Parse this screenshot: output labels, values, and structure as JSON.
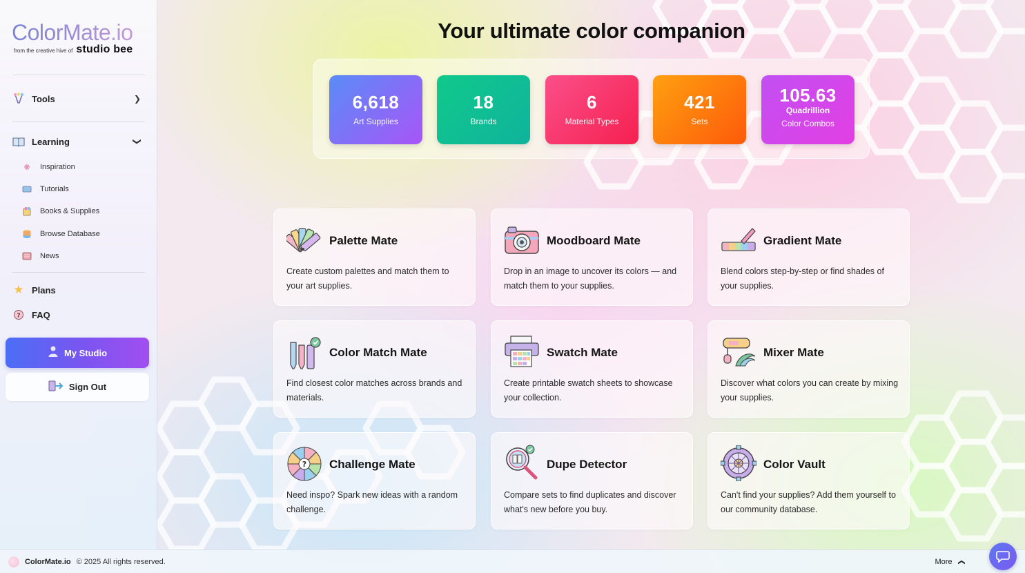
{
  "brand": {
    "title": "ColorMate.io",
    "from_text": "from the creative hive of",
    "studio_name": "studio bee"
  },
  "sidebar": {
    "tools_label": "Tools",
    "learning_label": "Learning",
    "learning_items": [
      {
        "label": "Inspiration",
        "icon": "lightbulb-icon"
      },
      {
        "label": "Tutorials",
        "icon": "video-icon"
      },
      {
        "label": "Books & Supplies",
        "icon": "books-icon"
      },
      {
        "label": "Browse Database",
        "icon": "database-icon"
      },
      {
        "label": "News",
        "icon": "newspaper-icon"
      }
    ],
    "plans_label": "Plans",
    "faq_label": "FAQ",
    "my_studio_label": "My Studio",
    "sign_out_label": "Sign Out"
  },
  "main": {
    "headline": "Your ultimate color companion",
    "stats": [
      {
        "value": "6,618",
        "label": "Art Supplies",
        "color_from": "#5a8cf7",
        "color_to": "#a855f7"
      },
      {
        "value": "18",
        "label": "Brands",
        "color_from": "#10c98b",
        "color_to": "#0fb39c"
      },
      {
        "value": "6",
        "label": "Material Types",
        "color_from": "#fb4f8a",
        "color_to": "#f5204f"
      },
      {
        "value": "421",
        "label": "Sets",
        "color_from": "#ffa010",
        "color_to": "#fd5a0a"
      },
      {
        "value": "105.63",
        "sub": "Quadrillion",
        "label": "Color Combos",
        "color_from": "#c24ff3",
        "color_to": "#e23fe2"
      }
    ],
    "cards": [
      {
        "title": "Palette Mate",
        "desc": "Create custom palettes and match them to your art supplies.",
        "icon": "palette-fan-icon"
      },
      {
        "title": "Moodboard Mate",
        "desc": "Drop in an image to uncover its colors — and match them to your supplies.",
        "icon": "camera-icon"
      },
      {
        "title": "Gradient Mate",
        "desc": "Blend colors step-by-step or find shades of your supplies.",
        "icon": "gradient-brush-icon"
      },
      {
        "title": "Color Match Mate",
        "desc": "Find closest color matches across brands and materials.",
        "icon": "pencils-icon"
      },
      {
        "title": "Swatch Mate",
        "desc": "Create printable swatch sheets to showcase your collection.",
        "icon": "printer-icon"
      },
      {
        "title": "Mixer Mate",
        "desc": "Discover what colors you can create by mixing your supplies.",
        "icon": "mixer-icon"
      },
      {
        "title": "Challenge Mate",
        "desc": "Need inspo? Spark new ideas with a random challenge.",
        "icon": "wheel-icon"
      },
      {
        "title": "Dupe Detector",
        "desc": "Compare sets to find duplicates and discover what's new before you buy.",
        "icon": "magnifier-icon"
      },
      {
        "title": "Color Vault",
        "desc": "Can't find your supplies? Add them yourself to our community database.",
        "icon": "vault-icon"
      }
    ]
  },
  "footer": {
    "name": "ColorMate.io",
    "copyright": "© 2025 All rights reserved.",
    "more_label": "More"
  }
}
